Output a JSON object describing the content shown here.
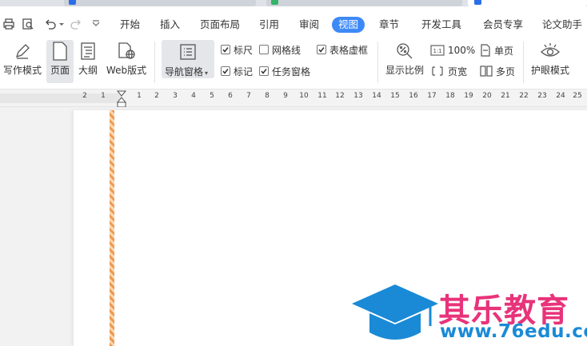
{
  "menu": {
    "items": [
      "开始",
      "插入",
      "页面布局",
      "引用",
      "审阅",
      "视图",
      "章节",
      "开发工具",
      "会员专享",
      "论文助手"
    ],
    "active": "视图"
  },
  "ribbon": {
    "write_mode": "写作模式",
    "page": "页面",
    "outline": "大纲",
    "web_layout": "Web版式",
    "nav_pane": "导航窗格",
    "checks": {
      "ruler": {
        "label": "标尺",
        "checked": true
      },
      "gridlines": {
        "label": "网格线",
        "checked": false
      },
      "table_gridlines": {
        "label": "表格虚框",
        "checked": true
      },
      "marks": {
        "label": "标记",
        "checked": true
      },
      "task_pane": {
        "label": "任务窗格",
        "checked": true
      }
    },
    "zoom": "显示比例",
    "zoom_100": "100%",
    "page_width": "页宽",
    "single_page": "单页",
    "multi_page": "多页",
    "eye_mode": "护眼模式"
  },
  "ruler": {
    "ticks": [
      "2",
      "1",
      "1",
      "2",
      "3",
      "4",
      "5",
      "6",
      "7",
      "8",
      "9",
      "10",
      "11",
      "12",
      "13",
      "14",
      "15",
      "16",
      "17",
      "18",
      "19",
      "20",
      "21",
      "22",
      "23",
      "24",
      "25"
    ]
  },
  "watermark": {
    "name": "其乐教育",
    "url": "www.76edu.com"
  },
  "colors": {
    "accent": "#3d8af7",
    "stripe": "#ef9a50",
    "logo_pink": "#e8337a",
    "logo_blue": "#1a8ad6"
  }
}
